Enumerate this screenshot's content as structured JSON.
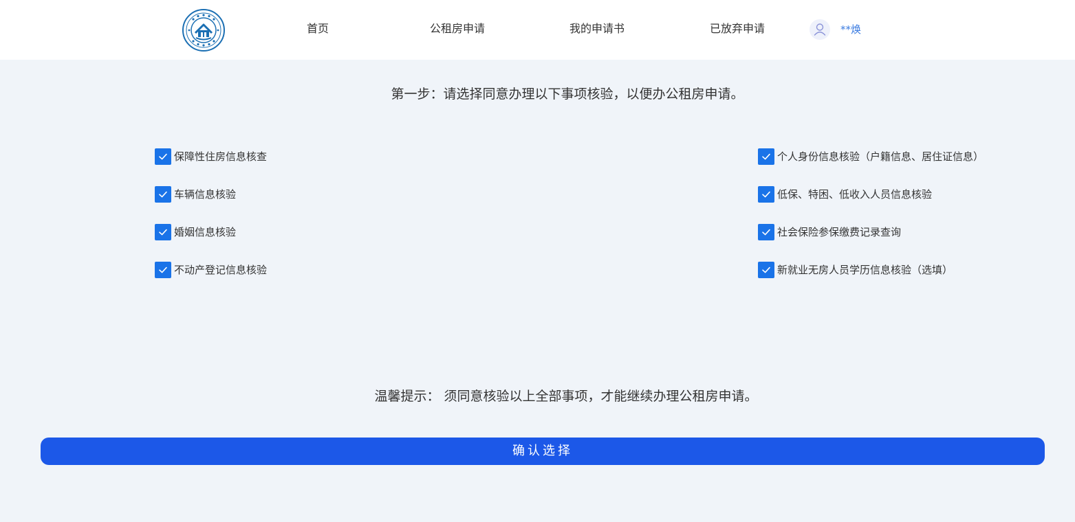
{
  "header": {
    "nav": [
      {
        "label": "首页"
      },
      {
        "label": "公租房申请"
      },
      {
        "label": "我的申请书"
      },
      {
        "label": "已放弃申请"
      }
    ],
    "user": {
      "name": "**焕"
    }
  },
  "main": {
    "step_title": "第一步：请选择同意办理以下事项核验，以便办公租房申请。",
    "left_items": [
      {
        "label": "保障性住房信息核查",
        "checked": true
      },
      {
        "label": "车辆信息核验",
        "checked": true
      },
      {
        "label": "婚姻信息核验",
        "checked": true
      },
      {
        "label": "不动产登记信息核验",
        "checked": true
      }
    ],
    "right_items": [
      {
        "label": "个人身份信息核验（户籍信息、居住证信息）",
        "checked": true
      },
      {
        "label": "低保、特困、低收入人员信息核验",
        "checked": true
      },
      {
        "label": "社会保险参保缴费记录查询",
        "checked": true
      },
      {
        "label": "新就业无房人员学历信息核验（选填）",
        "checked": true
      }
    ],
    "tip": "温馨提示：  须同意核验以上全部事项，才能继续办理公租房申请。",
    "confirm_label": "确认选择"
  },
  "colors": {
    "accent": "#1c58e8",
    "checkbox": "#1a73e8",
    "username": "#3a7be0",
    "background": "#f0f4f9"
  },
  "icons": {
    "logo": "logo-emblem",
    "avatar": "user-icon",
    "checkbox": "check-icon"
  }
}
